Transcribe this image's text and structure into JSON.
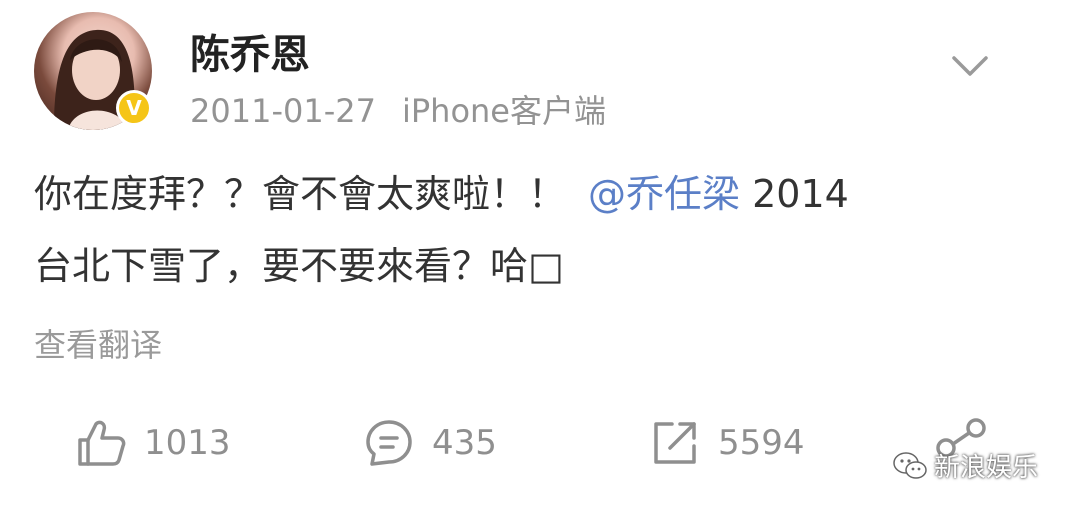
{
  "post": {
    "username": "陈乔恩",
    "date": "2011-01-27",
    "source": "iPhone客户端",
    "verified_badge": "V",
    "text_part1": "你在度拜？？會不會太爽啦！！",
    "mention": "@乔任梁",
    "text_part2": " 2014",
    "text_line2": "台北下雪了，要不要來看？哈□",
    "translate_label": "查看翻译"
  },
  "actions": {
    "like_count": "1013",
    "comment_count": "435",
    "repost_count": "5594"
  },
  "watermark": {
    "text": "新浪娱乐"
  },
  "colors": {
    "mention": "#5b7fc7",
    "verified": "#f5c518",
    "meta_gray": "#939393"
  },
  "icons": {
    "like": "thumbs-up-icon",
    "comment": "comment-icon",
    "repost": "repost-icon",
    "share": "share-icon",
    "chevron": "chevron-down-icon",
    "watermark": "wechat-icon"
  }
}
